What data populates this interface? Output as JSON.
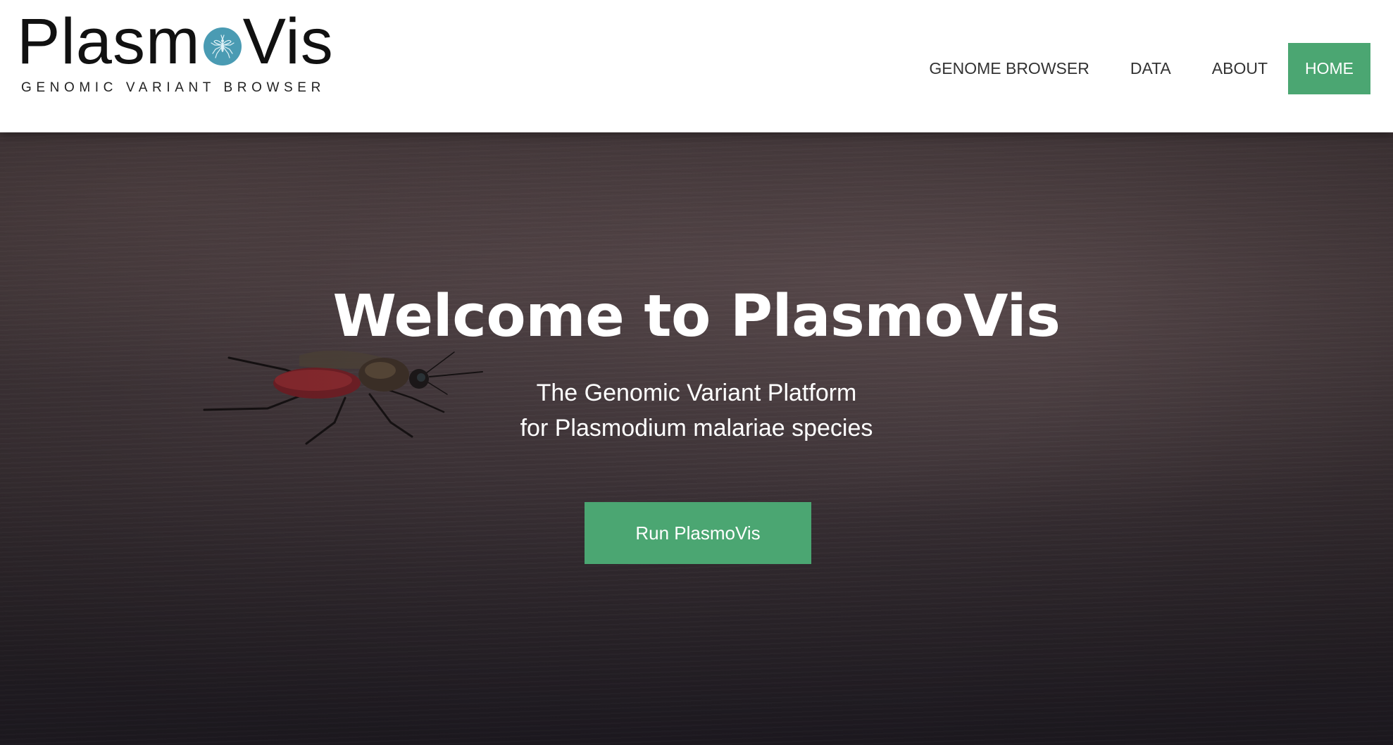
{
  "brand": {
    "name_part1": "Plasm",
    "name_part2": "Vis",
    "badge_icon": "mosquito-icon",
    "badge_color": "#4a9bb3",
    "tagline": "GENOMIC VARIANT BROWSER"
  },
  "nav": {
    "items": [
      {
        "label": "GENOME BROWSER",
        "active": false
      },
      {
        "label": "DATA",
        "active": false
      },
      {
        "label": "ABOUT",
        "active": false
      },
      {
        "label": "HOME",
        "active": true
      }
    ],
    "active_color": "#4ba672"
  },
  "hero": {
    "title": "Welcome to PlasmoVis",
    "subtitle_line1": "The Genomic Variant Platform",
    "subtitle_line2": "for Plasmodium malariae species",
    "cta_label": "Run PlasmoVis",
    "cta_color": "#4ba672",
    "background_image": "mosquito-on-skin-photo"
  }
}
